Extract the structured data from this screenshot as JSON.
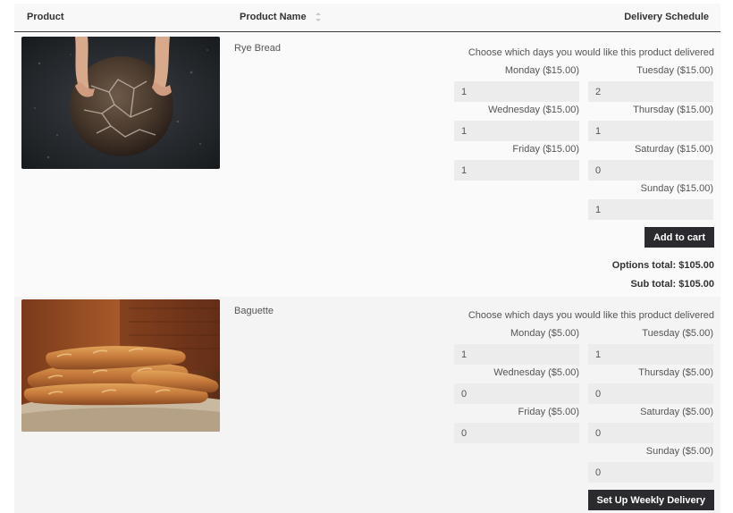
{
  "header": {
    "col_product": "Product",
    "col_name": "Product Name",
    "col_schedule": "Delivery Schedule"
  },
  "products": [
    {
      "name": "Rye Bread",
      "image_icon": "rye-bread-photo",
      "schedule_title": "Choose which days you would like this product delivered",
      "days": [
        {
          "label": "Monday ($15.00)",
          "value": "1"
        },
        {
          "label": "Tuesday ($15.00)",
          "value": "2"
        },
        {
          "label": "Wednesday ($15.00)",
          "value": "1"
        },
        {
          "label": "Thursday ($15.00)",
          "value": "1"
        },
        {
          "label": "Friday ($15.00)",
          "value": "1"
        },
        {
          "label": "Saturday ($15.00)",
          "value": "0"
        },
        {
          "label": "Sunday ($15.00)",
          "value": "1"
        }
      ],
      "button_label": "Add to cart",
      "options_total": "Options total: $105.00",
      "sub_total": "Sub total: $105.00"
    },
    {
      "name": "Baguette",
      "image_icon": "baguette-photo",
      "schedule_title": "Choose which days you would like this product delivered",
      "days": [
        {
          "label": "Monday ($5.00)",
          "value": "1"
        },
        {
          "label": "Tuesday ($5.00)",
          "value": "1"
        },
        {
          "label": "Wednesday ($5.00)",
          "value": "0"
        },
        {
          "label": "Thursday ($5.00)",
          "value": "0"
        },
        {
          "label": "Friday ($5.00)",
          "value": "0"
        },
        {
          "label": "Saturday ($5.00)",
          "value": "0"
        },
        {
          "label": "Sunday ($5.00)",
          "value": "0"
        }
      ],
      "button_label": "Set Up Weekly Delivery"
    }
  ],
  "colors": {
    "button_bg": "#2b2b2f",
    "input_bg": "#ececec",
    "header_rule": "#3a3a3a"
  }
}
